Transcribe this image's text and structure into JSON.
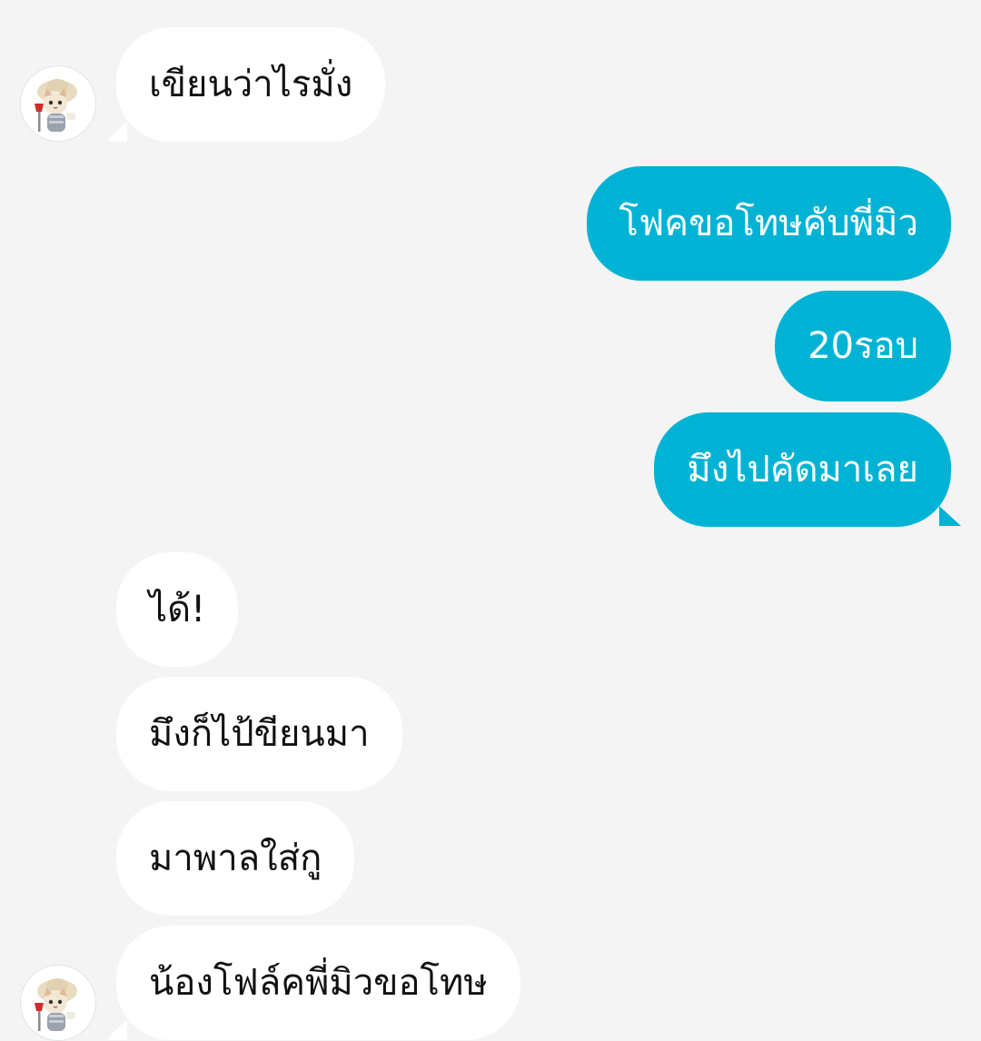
{
  "messages": [
    {
      "side": "received",
      "text": "เขียนว่าไรมั่ง",
      "has_avatar": true
    },
    {
      "side": "sent",
      "text": "โฟคขอโทษคับพี่มิว"
    },
    {
      "side": "sent",
      "text": "20รอบ"
    },
    {
      "side": "sent",
      "text": "มึงไปคัดมาเลย"
    },
    {
      "side": "received",
      "text": "ได้!"
    },
    {
      "side": "received",
      "text": "มึงก็ไป้ขียนมา"
    },
    {
      "side": "received",
      "text": "มาพาลใส่กู"
    },
    {
      "side": "received",
      "text": "น้องโฟล์คพี่มิวขอโทษ",
      "has_avatar": true
    }
  ],
  "colors": {
    "background": "#f4f4f4",
    "received_bubble": "#ffffff",
    "sent_bubble": "#00b3d4",
    "sent_text": "#ffffff",
    "received_text": "#111111"
  },
  "avatar_icon": "cat-with-sun-hat-avatar"
}
